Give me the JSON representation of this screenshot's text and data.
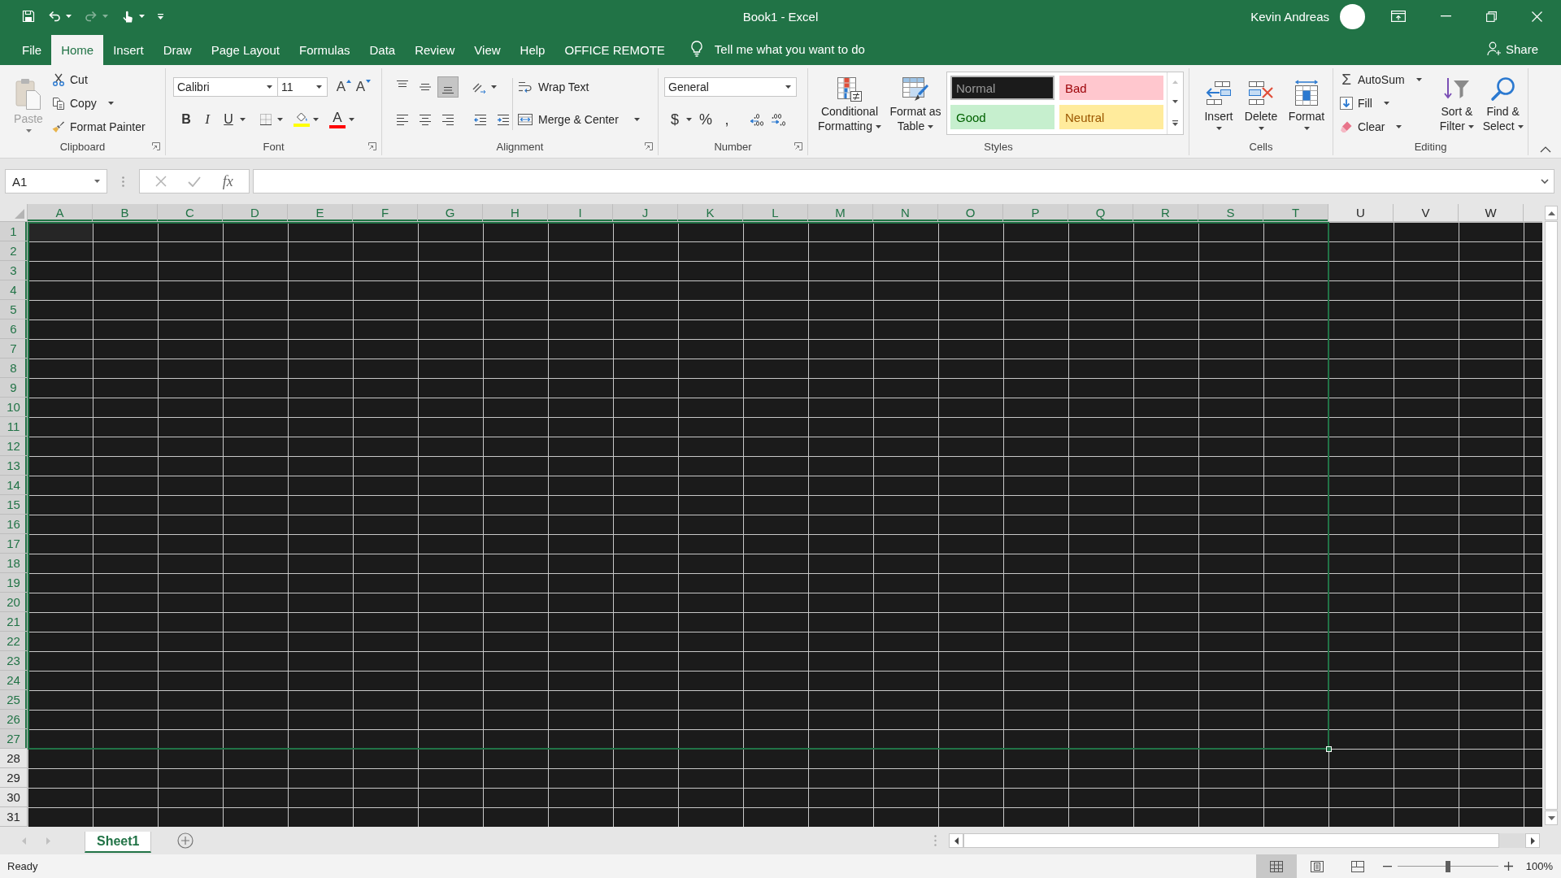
{
  "window": {
    "title": "Book1 - Excel",
    "user": "Kevin Andreas"
  },
  "quick_access": [
    {
      "kind": "save",
      "disabled": false
    },
    {
      "kind": "undo",
      "disabled": false
    },
    {
      "kind": "redo",
      "disabled": true
    },
    {
      "kind": "touch",
      "disabled": false
    }
  ],
  "tabs": [
    {
      "label": "File",
      "selected": false
    },
    {
      "label": "Home",
      "selected": true
    },
    {
      "label": "Insert",
      "selected": false
    },
    {
      "label": "Draw",
      "selected": false
    },
    {
      "label": "Page Layout",
      "selected": false
    },
    {
      "label": "Formulas",
      "selected": false
    },
    {
      "label": "Data",
      "selected": false
    },
    {
      "label": "Review",
      "selected": false
    },
    {
      "label": "View",
      "selected": false
    },
    {
      "label": "Help",
      "selected": false
    },
    {
      "label": "OFFICE REMOTE",
      "selected": false
    }
  ],
  "tell_me": {
    "placeholder": "Tell me what you want to do"
  },
  "share": {
    "label": "Share"
  },
  "ribbon": {
    "clipboard": {
      "label": "Clipboard",
      "paste": {
        "label": "Paste",
        "disabled": true
      },
      "items": [
        {
          "kind": "cut",
          "label": "Cut"
        },
        {
          "kind": "copy",
          "label": "Copy"
        },
        {
          "kind": "painter",
          "label": "Format Painter"
        }
      ]
    },
    "font": {
      "label": "Font",
      "name": "Calibri",
      "size": "11",
      "size_buttons": [
        {
          "kind": "grow",
          "label": "A"
        },
        {
          "kind": "shrink",
          "label": "A"
        }
      ],
      "style_buttons": [
        {
          "kind": "bold",
          "label": "B"
        },
        {
          "kind": "italic",
          "label": "I"
        },
        {
          "kind": "underline",
          "label": "U"
        }
      ],
      "color_tools": [
        {
          "kind": "fill",
          "color": "#ffff00"
        },
        {
          "kind": "font",
          "label": "A",
          "color": "#ff0000"
        }
      ]
    },
    "alignment": {
      "label": "Alignment",
      "vertical": [
        {
          "kind": "top",
          "selected": false
        },
        {
          "kind": "middle",
          "selected": false
        },
        {
          "kind": "bottom",
          "selected": true
        }
      ],
      "horizontal": [
        {
          "kind": "left",
          "selected": false
        },
        {
          "kind": "center",
          "selected": false
        },
        {
          "kind": "right",
          "selected": false
        }
      ],
      "wrap": "Wrap Text",
      "merge": "Merge & Center"
    },
    "number": {
      "label": "Number",
      "format": "General",
      "buttons": [
        {
          "kind": "currency",
          "label": "$"
        },
        {
          "kind": "percent",
          "label": "%"
        },
        {
          "kind": "comma",
          "label": ","
        }
      ]
    },
    "styles": {
      "label": "Styles",
      "commands": [
        {
          "kind": "conditional",
          "label": "Conditional Formatting"
        },
        {
          "kind": "table",
          "label": "Format as Table"
        }
      ],
      "gallery": [
        {
          "kind": "normal",
          "label": "Normal",
          "selected": true
        },
        {
          "kind": "bad",
          "label": "Bad",
          "selected": false
        },
        {
          "kind": "good",
          "label": "Good",
          "selected": false
        },
        {
          "kind": "neutral",
          "label": "Neutral",
          "selected": false
        }
      ]
    },
    "cells": {
      "label": "Cells",
      "commands": [
        {
          "kind": "insert",
          "label": "Insert"
        },
        {
          "kind": "delete",
          "label": "Delete"
        },
        {
          "kind": "format",
          "label": "Format"
        }
      ]
    },
    "editing": {
      "label": "Editing",
      "items": [
        {
          "kind": "autosum",
          "icon": "Σ",
          "label": "AutoSum"
        },
        {
          "kind": "fill",
          "label": "Fill"
        },
        {
          "kind": "clear",
          "label": "Clear"
        }
      ],
      "commands": [
        {
          "kind": "sort",
          "label": "Sort & Filter"
        },
        {
          "kind": "find",
          "label": "Find & Select"
        }
      ]
    }
  },
  "formula_bar": {
    "name_box": "A1",
    "function_label": "fx"
  },
  "sheet": {
    "columns": [
      {
        "label": "A",
        "selected": true
      },
      {
        "label": "B",
        "selected": true
      },
      {
        "label": "C",
        "selected": true
      },
      {
        "label": "D",
        "selected": true
      },
      {
        "label": "E",
        "selected": true
      },
      {
        "label": "F",
        "selected": true
      },
      {
        "label": "G",
        "selected": true
      },
      {
        "label": "H",
        "selected": true
      },
      {
        "label": "I",
        "selected": true
      },
      {
        "label": "J",
        "selected": true
      },
      {
        "label": "K",
        "selected": true
      },
      {
        "label": "L",
        "selected": true
      },
      {
        "label": "M",
        "selected": true
      },
      {
        "label": "N",
        "selected": true
      },
      {
        "label": "O",
        "selected": true
      },
      {
        "label": "P",
        "selected": true
      },
      {
        "label": "Q",
        "selected": true
      },
      {
        "label": "R",
        "selected": true
      },
      {
        "label": "S",
        "selected": true
      },
      {
        "label": "T",
        "selected": true
      },
      {
        "label": "U",
        "selected": false
      },
      {
        "label": "V",
        "selected": false
      },
      {
        "label": "W",
        "selected": false
      }
    ],
    "rows": [
      {
        "label": "1",
        "selected": true
      },
      {
        "label": "2",
        "selected": true
      },
      {
        "label": "3",
        "selected": true
      },
      {
        "label": "4",
        "selected": true
      },
      {
        "label": "5",
        "selected": true
      },
      {
        "label": "6",
        "selected": true
      },
      {
        "label": "7",
        "selected": true
      },
      {
        "label": "8",
        "selected": true
      },
      {
        "label": "9",
        "selected": true
      },
      {
        "label": "10",
        "selected": true
      },
      {
        "label": "11",
        "selected": true
      },
      {
        "label": "12",
        "selected": true
      },
      {
        "label": "13",
        "selected": true
      },
      {
        "label": "14",
        "selected": true
      },
      {
        "label": "15",
        "selected": true
      },
      {
        "label": "16",
        "selected": true
      },
      {
        "label": "17",
        "selected": true
      },
      {
        "label": "18",
        "selected": true
      },
      {
        "label": "19",
        "selected": true
      },
      {
        "label": "20",
        "selected": true
      },
      {
        "label": "21",
        "selected": true
      },
      {
        "label": "22",
        "selected": true
      },
      {
        "label": "23",
        "selected": true
      },
      {
        "label": "24",
        "selected": true
      },
      {
        "label": "25",
        "selected": true
      },
      {
        "label": "26",
        "selected": true
      },
      {
        "label": "27",
        "selected": true
      },
      {
        "label": "28",
        "selected": false
      },
      {
        "label": "29",
        "selected": false
      },
      {
        "label": "30",
        "selected": false
      },
      {
        "label": "31",
        "selected": false
      }
    ]
  },
  "sheet_tabs": [
    {
      "label": "Sheet1",
      "selected": true
    }
  ],
  "status_bar": {
    "status": "Ready",
    "views": [
      {
        "kind": "normal",
        "selected": true
      },
      {
        "kind": "layout",
        "selected": false
      },
      {
        "kind": "break",
        "selected": false
      }
    ],
    "zoom": {
      "level": 0.5,
      "label": "100%"
    }
  }
}
